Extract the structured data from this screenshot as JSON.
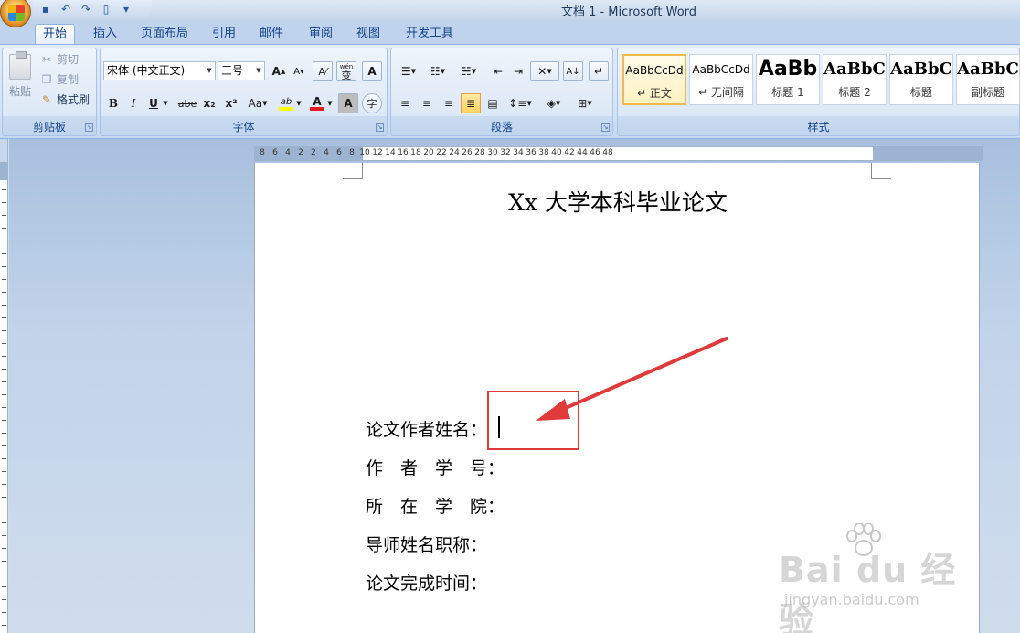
{
  "window": {
    "title": "文档 1 - Microsoft Word"
  },
  "quick_access": [
    {
      "icon": "save-icon",
      "glyph": "▪"
    },
    {
      "icon": "undo-icon",
      "glyph": "↶"
    },
    {
      "icon": "redo-icon",
      "glyph": "↷"
    },
    {
      "icon": "print-preview-icon",
      "glyph": "▯"
    },
    {
      "icon": "customize-icon",
      "glyph": "▾"
    }
  ],
  "tabs": [
    "开始",
    "插入",
    "页面布局",
    "引用",
    "邮件",
    "审阅",
    "视图",
    "开发工具"
  ],
  "active_tab": "开始",
  "clipboard": {
    "label": "剪贴板",
    "paste": "粘贴",
    "cut": "剪切",
    "copy": "复制",
    "format_painter": "格式刷"
  },
  "font": {
    "label": "字体",
    "font_name": "宋体 (中文正文)",
    "font_size": "三号",
    "bold": "B",
    "italic": "I",
    "underline": "U",
    "strike": "abe",
    "subscript": "x₂",
    "superscript": "x²",
    "change_case": "Aa",
    "grow": "A",
    "shrink": "A",
    "phonetic": "wén",
    "phonetic_char": "变",
    "char_border": "A",
    "highlight": "ab",
    "font_color": "A",
    "char_shading": "A",
    "enclose": "字",
    "highlight_color": "#ffff00",
    "font_color_value": "#e31b1b"
  },
  "paragraph": {
    "label": "段落"
  },
  "styles": {
    "label": "样式",
    "items": [
      {
        "sample": "AaBbCcDd",
        "name": "↵ 正文",
        "selected": true
      },
      {
        "sample": "AaBbCcDd",
        "name": "↵ 无间隔",
        "selected": false
      },
      {
        "sample": "AaBb",
        "name": "标题 1",
        "selected": false
      },
      {
        "sample": "AaBbC",
        "name": "标题 2",
        "selected": false
      },
      {
        "sample": "AaBbC",
        "name": "标题",
        "selected": false
      },
      {
        "sample": "AaBbC",
        "name": "副标题",
        "selected": false
      }
    ]
  },
  "ruler": {
    "numbers": [
      "8",
      "6",
      "4",
      "2",
      "2",
      "4",
      "6",
      "8",
      "10",
      "12",
      "14",
      "16",
      "18",
      "20",
      "22",
      "24",
      "26",
      "28",
      "30",
      "32",
      "34",
      "36",
      "38",
      "40",
      "42",
      "44",
      "46",
      "48"
    ]
  },
  "document": {
    "title": "Xx 大学本科毕业论文",
    "fields": [
      "论文作者姓名：",
      "作　者　学　号：",
      "所　在　学　院：",
      "导师姓名职称：",
      "论文完成时间："
    ]
  },
  "annotation": {
    "box_color": "#e03a3a",
    "arrow_color": "#e03a3a"
  },
  "watermark": {
    "main": "Bai du 经验",
    "sub": "jingyan.baidu.com"
  }
}
